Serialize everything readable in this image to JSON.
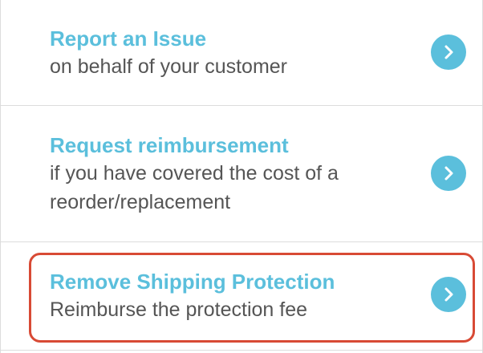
{
  "menu": {
    "items": [
      {
        "title": "Report an Issue",
        "description": "on behalf of your customer",
        "icon": "chevron-right-icon"
      },
      {
        "title": "Request reimbursement",
        "description": "if you have covered the cost of a reorder/replacement",
        "icon": "chevron-right-icon"
      },
      {
        "title": "Remove Shipping Protection",
        "description": "Reimburse the protection fee",
        "icon": "chevron-right-icon",
        "highlighted": true
      }
    ]
  },
  "colors": {
    "accent": "#5bbfdc",
    "text": "#555555",
    "divider": "#dcdcdc",
    "highlight": "#d84a35"
  }
}
